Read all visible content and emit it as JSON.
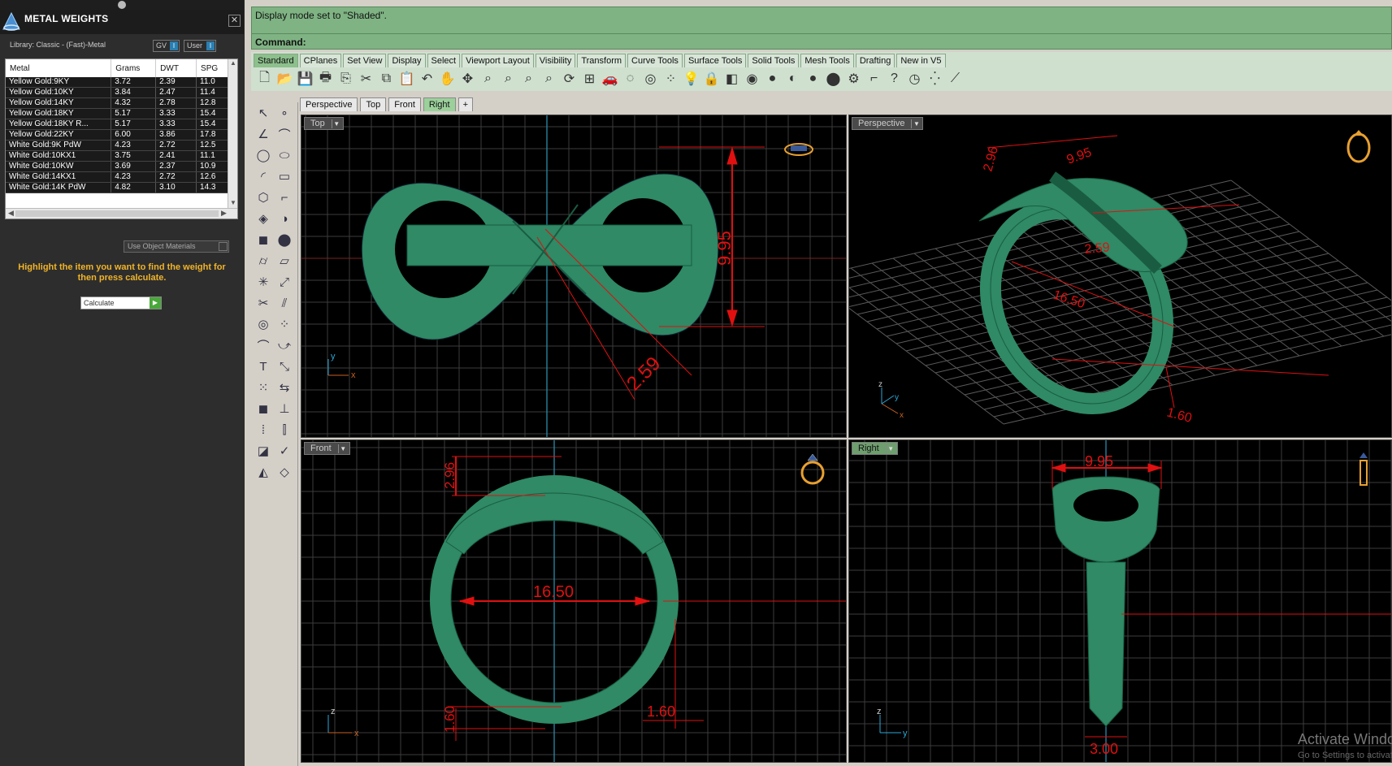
{
  "left_panel": {
    "title": "METAL WEIGHTS",
    "close": "✕",
    "library": "Library: Classic - (Fast)-Metal",
    "gv_label": "GV",
    "user_label": "User",
    "toggle_key": "I",
    "columns": [
      "Metal",
      "Grams",
      "DWT",
      "SPG"
    ],
    "rows": [
      [
        "Yellow Gold:9KY",
        "3.72",
        "2.39",
        "11.0"
      ],
      [
        "Yellow Gold:10KY",
        "3.84",
        "2.47",
        "11.4"
      ],
      [
        "Yellow Gold:14KY",
        "4.32",
        "2.78",
        "12.8"
      ],
      [
        "Yellow Gold:18KY",
        "5.17",
        "3.33",
        "15.4"
      ],
      [
        "Yellow Gold:18KY R...",
        "5.17",
        "3.33",
        "15.4"
      ],
      [
        "Yellow Gold:22KY",
        "6.00",
        "3.86",
        "17.8"
      ],
      [
        "White Gold:9K PdW",
        "4.23",
        "2.72",
        "12.5"
      ],
      [
        "White Gold:10KX1",
        "3.75",
        "2.41",
        "11.1"
      ],
      [
        "White Gold:10KW",
        "3.69",
        "2.37",
        "10.9"
      ],
      [
        "White Gold:14KX1",
        "4.23",
        "2.72",
        "12.6"
      ],
      [
        "White Gold:14K PdW",
        "4.82",
        "3.10",
        "14.3"
      ]
    ],
    "use_object_materials": "Use Object Materials",
    "hint": "Highlight the item you want to find the weight for then press calculate.",
    "calculate": "Calculate"
  },
  "command": {
    "status": "Display mode set to \"Shaded\".",
    "label": "Command:"
  },
  "toolbar_tabs": [
    "Standard",
    "CPlanes",
    "Set View",
    "Display",
    "Select",
    "Viewport Layout",
    "Visibility",
    "Transform",
    "Curve Tools",
    "Surface Tools",
    "Solid Tools",
    "Mesh Tools",
    "Drafting",
    "New in V5"
  ],
  "toolbar_icons": [
    "new-file-icon",
    "open-file-icon",
    "save-icon",
    "print-icon",
    "import-icon",
    "cut-icon",
    "copy-icon",
    "paste-icon",
    "undo-icon",
    "pan-icon",
    "move-view-icon",
    "zoom-icon",
    "zoom-window-icon",
    "zoom-extents-icon",
    "zoom-selected-icon",
    "rotate-view-icon",
    "four-views-icon",
    "car-icon",
    "ghosted-icon",
    "osnap-icon",
    "grid-snap-icon",
    "light-icon",
    "lock-icon",
    "material-icon",
    "color-wheel-icon",
    "shade-icon",
    "render-icon",
    "sphere-icon",
    "render-preview-icon",
    "gear-icon",
    "dimension-icon",
    "help-icon",
    "clock-icon",
    "points-icon",
    "check-line-icon"
  ],
  "viewport_tabs": [
    "Perspective",
    "Top",
    "Front",
    "Right",
    "+"
  ],
  "viewports": {
    "top": {
      "label": "Top",
      "dims": [
        "9.95",
        "2.59"
      ]
    },
    "perspective": {
      "label": "Perspective",
      "dims": [
        "2.96",
        "9.95",
        "2.59",
        "16.50",
        "1.60"
      ]
    },
    "front": {
      "label": "Front",
      "dims": [
        "2.96",
        "16.50",
        "1.60",
        "1.60"
      ]
    },
    "right": {
      "label": "Right",
      "dims": [
        "9.95",
        "3.00"
      ]
    }
  },
  "axes": {
    "x": "x",
    "y": "y",
    "z": "z"
  },
  "watermark": {
    "line1": "Activate Windows",
    "line2": "Go to Settings to activate Windows."
  },
  "colors": {
    "shape": "#2f8a65",
    "dim": "#e01010",
    "grid": "#3c3c3c",
    "accent_green": "#7fb383"
  }
}
